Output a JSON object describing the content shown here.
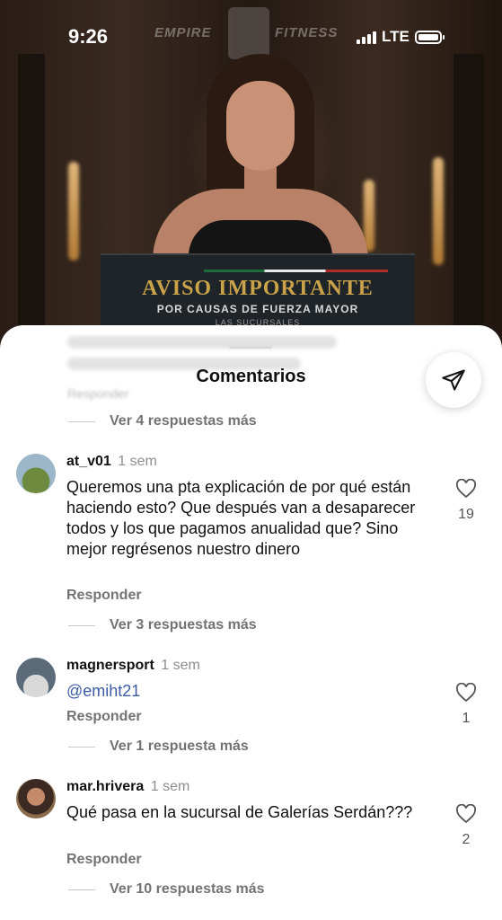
{
  "status_bar": {
    "time": "9:26",
    "network": "LTE"
  },
  "post": {
    "brand_left": "EMPIRE",
    "brand_right": "FITNESS",
    "notice_title": "AVISO IMPORTANTE",
    "notice_subtitle": "POR CAUSAS DE FUERZA MAYOR",
    "notice_line3": "LAS SUCURSALES"
  },
  "sheet": {
    "title": "Comentarios",
    "share_icon": "send-icon",
    "first_more_replies": "Ver 4 respuestas más",
    "blurred_reply_label": "Responder"
  },
  "comments": [
    {
      "username": "at_v01",
      "time": "1 sem",
      "text": "Queremos una pta explicación de por qué están haciendo esto? Que después van a desaparecer todos y los que pagamos anualidad que? Sino mejor regrésenos nuestro dinero",
      "reply_label": "Responder",
      "likes": "19",
      "more_replies": "Ver 3 respuestas más"
    },
    {
      "username": "magnersport",
      "time": "1 sem",
      "text": "@emiht21",
      "reply_label": "Responder",
      "likes": "1",
      "more_replies": "Ver 1 respuesta más"
    },
    {
      "username": "mar.hrivera",
      "time": "1 sem",
      "text": "Qué pasa en la sucursal de Galerías Serdán???",
      "reply_label": "Responder",
      "likes": "2",
      "more_replies": "Ver 10 respuestas más"
    }
  ]
}
